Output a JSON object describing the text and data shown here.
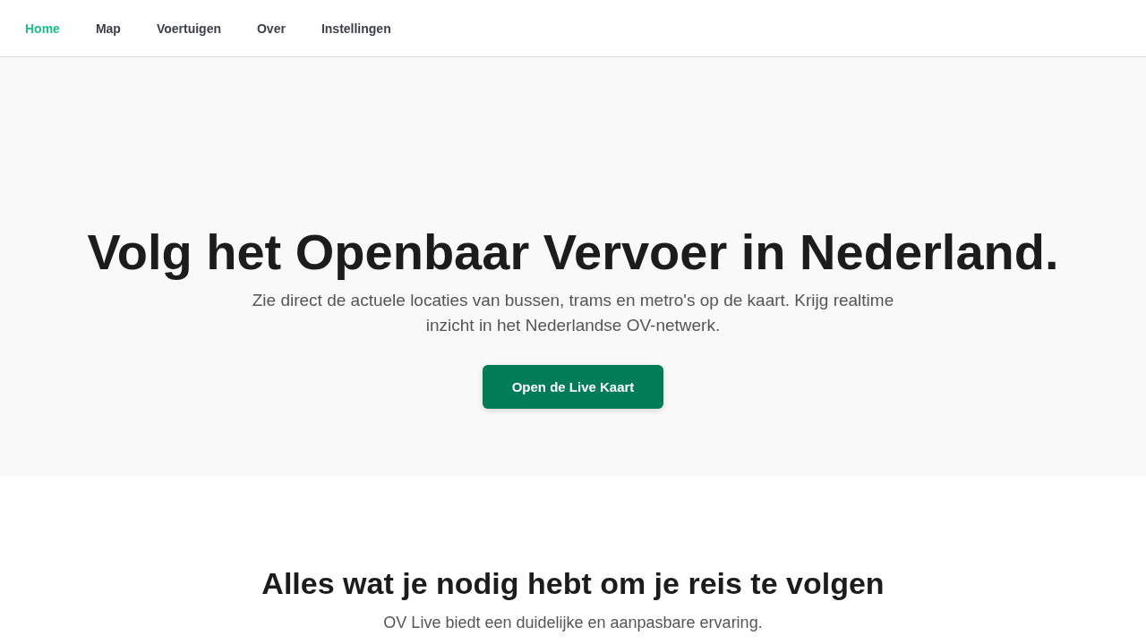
{
  "nav": {
    "items": [
      {
        "label": "Home",
        "selected": true
      },
      {
        "label": "Map",
        "selected": false
      },
      {
        "label": "Voertuigen",
        "selected": false
      },
      {
        "label": "Over",
        "selected": false
      },
      {
        "label": "Instellingen",
        "selected": false
      }
    ]
  },
  "hero": {
    "title": "Volg het Openbaar Vervoer in Nederland.",
    "subtitle": "Zie direct de actuele locaties van bussen, trams en metro's op de kaart. Krijg realtime inzicht in het Nederlandse OV-netwerk.",
    "button": "Open de Live Kaart"
  },
  "features": {
    "title": "Alles wat je nodig hebt om je reis te volgen",
    "subtitle": "OV Live biedt een duidelijke en aanpasbare ervaring."
  }
}
